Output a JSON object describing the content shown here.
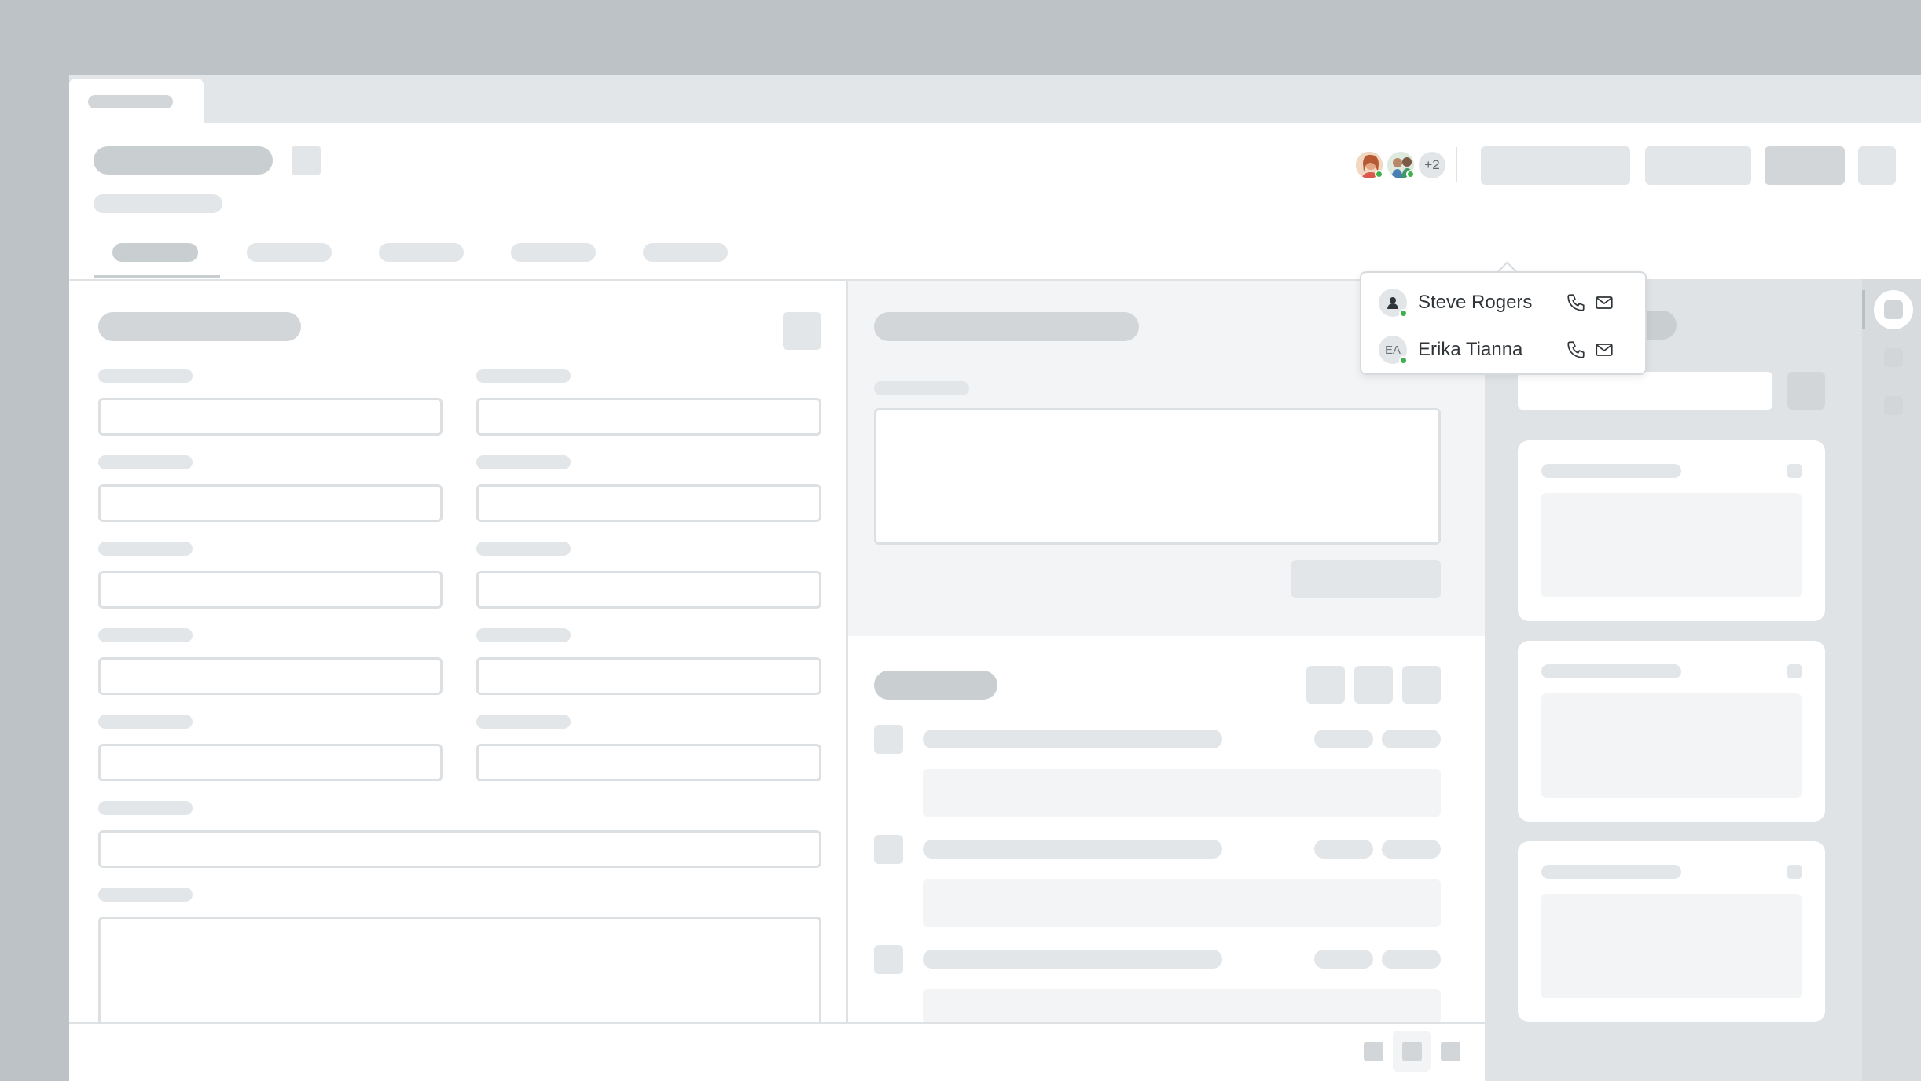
{
  "header": {
    "more_avatars_label": "+2"
  },
  "contacts_popover": {
    "contacts": [
      {
        "name": "Steve Rogers",
        "initials": "",
        "status": "online"
      },
      {
        "name": "Erika Tianna",
        "initials": "EA",
        "status": "online"
      }
    ]
  },
  "colors": {
    "status_online": "#3fb04a",
    "placeholder_light": "#e3e6e8",
    "placeholder_dark": "#d2d6d9"
  }
}
